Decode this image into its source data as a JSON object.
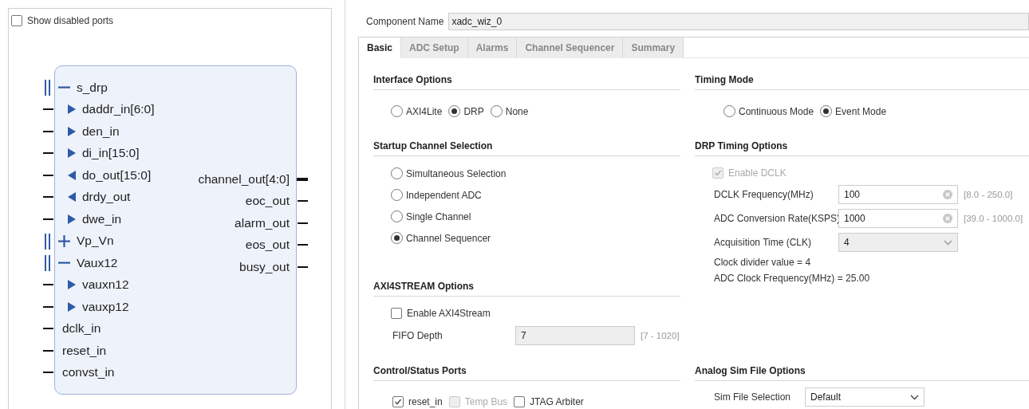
{
  "show_disabled_ports": {
    "label": "Show disabled ports",
    "checked": false
  },
  "symbol": {
    "left_ports": [
      {
        "kind": "interface",
        "name": "s_drp",
        "expanded": true,
        "children": [
          {
            "kind": "port",
            "name": "daddr_in[6:0]",
            "output": false
          },
          {
            "kind": "port",
            "name": "den_in",
            "output": false
          },
          {
            "kind": "port",
            "name": "di_in[15:0]",
            "output": false
          },
          {
            "kind": "port",
            "name": "do_out[15:0]",
            "output": true
          },
          {
            "kind": "port",
            "name": "drdy_out",
            "output": true
          },
          {
            "kind": "port",
            "name": "dwe_in",
            "output": false
          }
        ]
      },
      {
        "kind": "interface",
        "name": "Vp_Vn",
        "expanded": false
      },
      {
        "kind": "interface",
        "name": "Vaux12",
        "expanded": true,
        "children": [
          {
            "kind": "port",
            "name": "vauxn12",
            "output": false
          },
          {
            "kind": "port",
            "name": "vauxp12",
            "output": false
          }
        ]
      },
      {
        "kind": "port",
        "name": "dclk_in"
      },
      {
        "kind": "port",
        "name": "reset_in"
      },
      {
        "kind": "port",
        "name": "convst_in"
      }
    ],
    "right_ports": [
      {
        "name": "channel_out[4:0]",
        "bus": true
      },
      {
        "name": "eoc_out",
        "bus": false
      },
      {
        "name": "alarm_out",
        "bus": false
      },
      {
        "name": "eos_out",
        "bus": false
      },
      {
        "name": "busy_out",
        "bus": false
      }
    ]
  },
  "component_name": {
    "label": "Component Name",
    "value": "xadc_wiz_0"
  },
  "tabs": [
    {
      "label": "Basic",
      "selected": true
    },
    {
      "label": "ADC Setup",
      "selected": false
    },
    {
      "label": "Alarms",
      "selected": false
    },
    {
      "label": "Channel Sequencer",
      "selected": false
    },
    {
      "label": "Summary",
      "selected": false
    }
  ],
  "interface_options": {
    "title": "Interface Options",
    "options": [
      {
        "label": "AXI4Lite",
        "selected": false
      },
      {
        "label": "DRP",
        "selected": true
      },
      {
        "label": "None",
        "selected": false
      }
    ]
  },
  "startup_channel_selection": {
    "title": "Startup Channel Selection",
    "options": [
      {
        "label": "Simultaneous Selection",
        "selected": false
      },
      {
        "label": "Independent ADC",
        "selected": false
      },
      {
        "label": "Single Channel",
        "selected": false
      },
      {
        "label": "Channel Sequencer",
        "selected": true
      }
    ]
  },
  "axi4stream_options": {
    "title": "AXI4STREAM Options",
    "enable": {
      "label": "Enable AXI4Stream",
      "checked": false
    },
    "fifo_depth": {
      "label": "FIFO Depth",
      "value": "7",
      "range": "[7 - 1020]",
      "disabled": true
    }
  },
  "control_status_ports": {
    "title": "Control/Status Ports",
    "options": [
      {
        "label": "reset_in",
        "checked": true,
        "disabled": false
      },
      {
        "label": "Temp Bus",
        "checked": false,
        "disabled": true
      },
      {
        "label": "JTAG Arbiter",
        "checked": false,
        "disabled": false
      }
    ]
  },
  "timing_mode": {
    "title": "Timing Mode",
    "options": [
      {
        "label": "Continuous Mode",
        "selected": false
      },
      {
        "label": "Event Mode",
        "selected": true
      }
    ]
  },
  "drp_timing_options": {
    "title": "DRP Timing Options",
    "enable_dclk": {
      "label": "Enable DCLK",
      "checked": true,
      "disabled": true
    },
    "fields": [
      {
        "kind": "text",
        "label": "DCLK Frequency(MHz)",
        "value": "100",
        "range": "[8.0 - 250.0]"
      },
      {
        "kind": "text",
        "label": "ADC Conversion Rate(KSPS)",
        "value": "1000",
        "range": "[39.0 - 1000.0]"
      },
      {
        "kind": "select",
        "label": "Acquisition Time (CLK)",
        "value": "4",
        "disabled": true
      }
    ],
    "notes": [
      "Clock divider value = 4",
      "ADC Clock Frequency(MHz) = 25.00"
    ]
  },
  "analog_sim_file_options": {
    "title": "Analog Sim File Options",
    "fields": [
      {
        "kind": "select",
        "label": "Sim File Selection",
        "value": "Default",
        "disabled": false
      }
    ]
  }
}
